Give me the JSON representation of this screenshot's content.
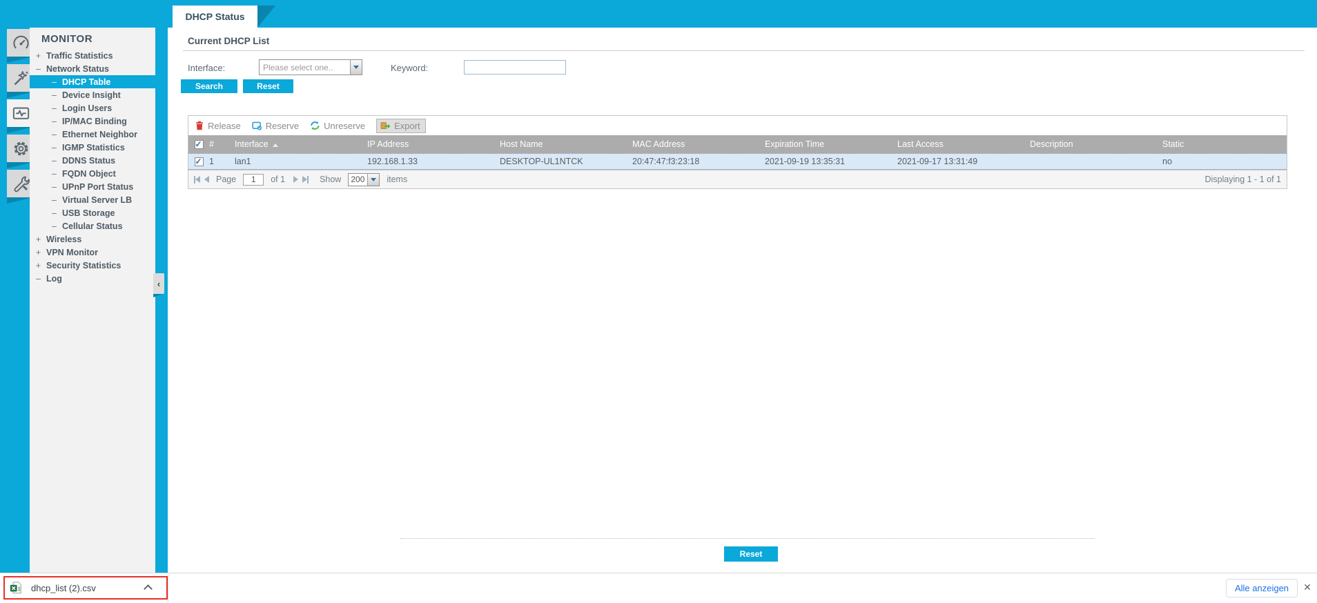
{
  "app": {
    "tab_title": "DHCP Status"
  },
  "colors": {
    "accent_cyan": "#0ba8da",
    "accent_dark": "#0b85ad",
    "row_blue": "#d9e9f8",
    "header_gray": "#acacac",
    "annotation_red": "#e53125",
    "link_blue": "#1a73e8"
  },
  "icons": {
    "rail": [
      "gauge-icon",
      "wizard-icon",
      "activity-monitor-icon",
      "gear-icon",
      "maintenance-icon"
    ],
    "toolbar": [
      "trash-icon",
      "reserve-doc-icon",
      "unreserve-refresh-icon",
      "export-arrow-icon"
    ],
    "file": "excel-csv-icon"
  },
  "sidebar": {
    "section_title": "MONITOR",
    "collapse_glyph": "‹",
    "items": [
      {
        "prefix": "+",
        "label": "Traffic Statistics"
      },
      {
        "prefix": "–",
        "label": "Network Status"
      },
      {
        "prefix": "–",
        "label": "DHCP Table"
      },
      {
        "prefix": "–",
        "label": "Device Insight"
      },
      {
        "prefix": "–",
        "label": "Login Users"
      },
      {
        "prefix": "–",
        "label": "IP/MAC Binding"
      },
      {
        "prefix": "–",
        "label": "Ethernet Neighbor"
      },
      {
        "prefix": "–",
        "label": "IGMP Statistics"
      },
      {
        "prefix": "–",
        "label": "DDNS Status"
      },
      {
        "prefix": "–",
        "label": "FQDN Object"
      },
      {
        "prefix": "–",
        "label": "UPnP Port Status"
      },
      {
        "prefix": "–",
        "label": "Virtual Server LB"
      },
      {
        "prefix": "–",
        "label": "USB Storage"
      },
      {
        "prefix": "–",
        "label": "Cellular Status"
      },
      {
        "prefix": "+",
        "label": "Wireless"
      },
      {
        "prefix": "+",
        "label": "VPN Monitor"
      },
      {
        "prefix": "+",
        "label": "Security Statistics"
      },
      {
        "prefix": "–",
        "label": "Log"
      }
    ]
  },
  "content": {
    "heading": "Current DHCP List",
    "filter": {
      "interface_label": "Interface:",
      "interface_placeholder": "Please select one..",
      "keyword_label": "Keyword:",
      "keyword_value": "",
      "search_label": "Search",
      "reset_label": "Reset"
    },
    "toolbar": {
      "release": "Release",
      "reserve": "Reserve",
      "unreserve": "Unreserve",
      "export": "Export"
    },
    "table": {
      "columns": [
        "#",
        "Interface",
        "IP Address",
        "Host Name",
        "MAC Address",
        "Expiration Time",
        "Last Access",
        "Description",
        "Static"
      ],
      "sort_column": "Interface",
      "rows": [
        {
          "num": "1",
          "interface": "lan1",
          "ip": "192.168.1.33",
          "host": "DESKTOP-UL1NTCK",
          "mac": "20:47:47:f3:23:18",
          "expiration": "2021-09-19 13:35:31",
          "last_access": "2021-09-17 13:31:49",
          "description": "",
          "static": "no"
        }
      ]
    },
    "pagination": {
      "page_label": "Page",
      "page_value": "1",
      "of_label": "of 1",
      "show_label": "Show",
      "show_value": "200",
      "items_label": "items",
      "displaying": "Displaying 1 - 1 of 1"
    },
    "footer_reset": "Reset"
  },
  "download_bar": {
    "filename": "dhcp_list (2).csv",
    "show_all_label": "Alle anzeigen"
  }
}
